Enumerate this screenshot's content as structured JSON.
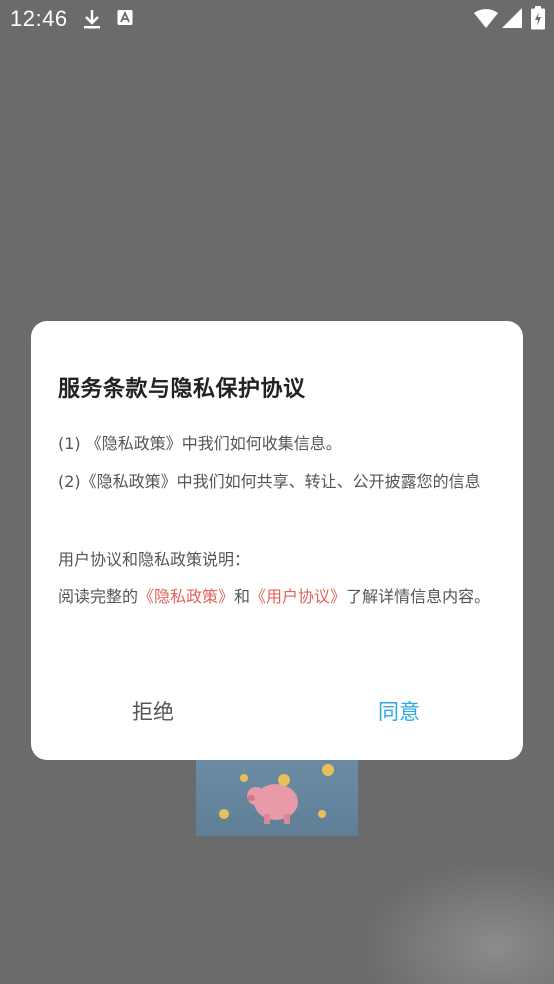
{
  "status_bar": {
    "time": "12:46",
    "icons": [
      "download-icon",
      "a-icon",
      "wifi-icon",
      "signal-icon",
      "battery-icon"
    ]
  },
  "dialog": {
    "title": "服务条款与隐私保护协议",
    "clause1": "(1) 《隐私政策》中我们如何收集信息。",
    "clause2": "(2)《隐私政策》中我们如何共享、转让、公开披露您的信息",
    "explain_heading": "用户协议和隐私政策说明：",
    "read_prefix": "阅读完整的",
    "privacy_link": "《隐私政策》",
    "and_text": "和",
    "user_link": "《用户协议》",
    "read_suffix": "了解详情信息内容。",
    "reject_label": "拒绝",
    "agree_label": "同意"
  },
  "colors": {
    "overlay": "#6b6b6b",
    "link": "#e0625e",
    "agree": "#29aae0",
    "dialog_bg": "#ffffff"
  }
}
